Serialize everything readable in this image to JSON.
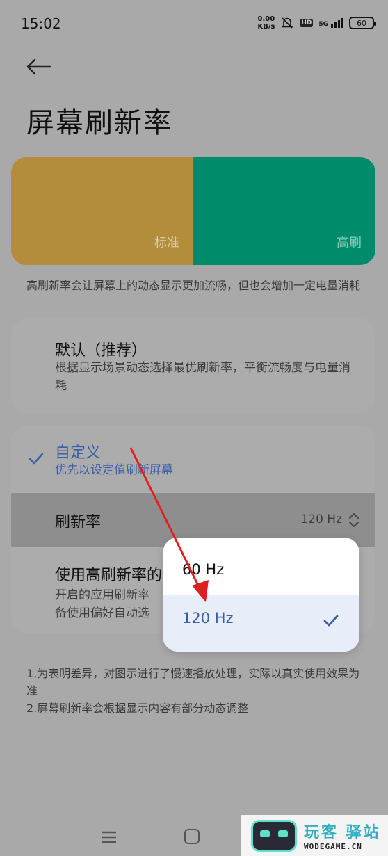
{
  "status_bar": {
    "time": "15:02",
    "net_speed_value": "0.00",
    "net_speed_unit": "KB/s",
    "hd_badge": "HD",
    "network": "5G",
    "battery": "60"
  },
  "header": {
    "title": "屏幕刷新率"
  },
  "preview": {
    "standard_label": "标准",
    "high_label": "高刷",
    "standard_color": "#b38d3b",
    "high_color": "#008c6a"
  },
  "description": "高刷新率会让屏幕上的动态显示更加流畅，但也会增加一定电量消耗",
  "options": {
    "default": {
      "title": "默认（推荐）",
      "subtitle": "根据显示场景动态选择最优刷新率，平衡流畅度与电量消耗"
    },
    "custom": {
      "title": "自定义",
      "subtitle": "优先以设定值刷新屏幕",
      "accent_color": "#3a5fa8"
    },
    "refresh_rate": {
      "label": "刷新率",
      "value": "120 Hz"
    },
    "high_refresh_apps": {
      "title": "使用高刷新率的",
      "subtitle": "开启的应用刷新率\n备使用偏好自动选"
    }
  },
  "popup": {
    "options": [
      "60 Hz",
      "120 Hz"
    ],
    "selected": "120 Hz"
  },
  "footnotes": {
    "note1": "1.为表明差异，对图示进行了慢速播放处理，实际以真实使用效果为准",
    "note2": "2.屏幕刷新率会根据显示内容有部分动态调整"
  },
  "watermark": {
    "cn_text": "玩客 驿站",
    "en_text": "WODEGAME.CN"
  }
}
